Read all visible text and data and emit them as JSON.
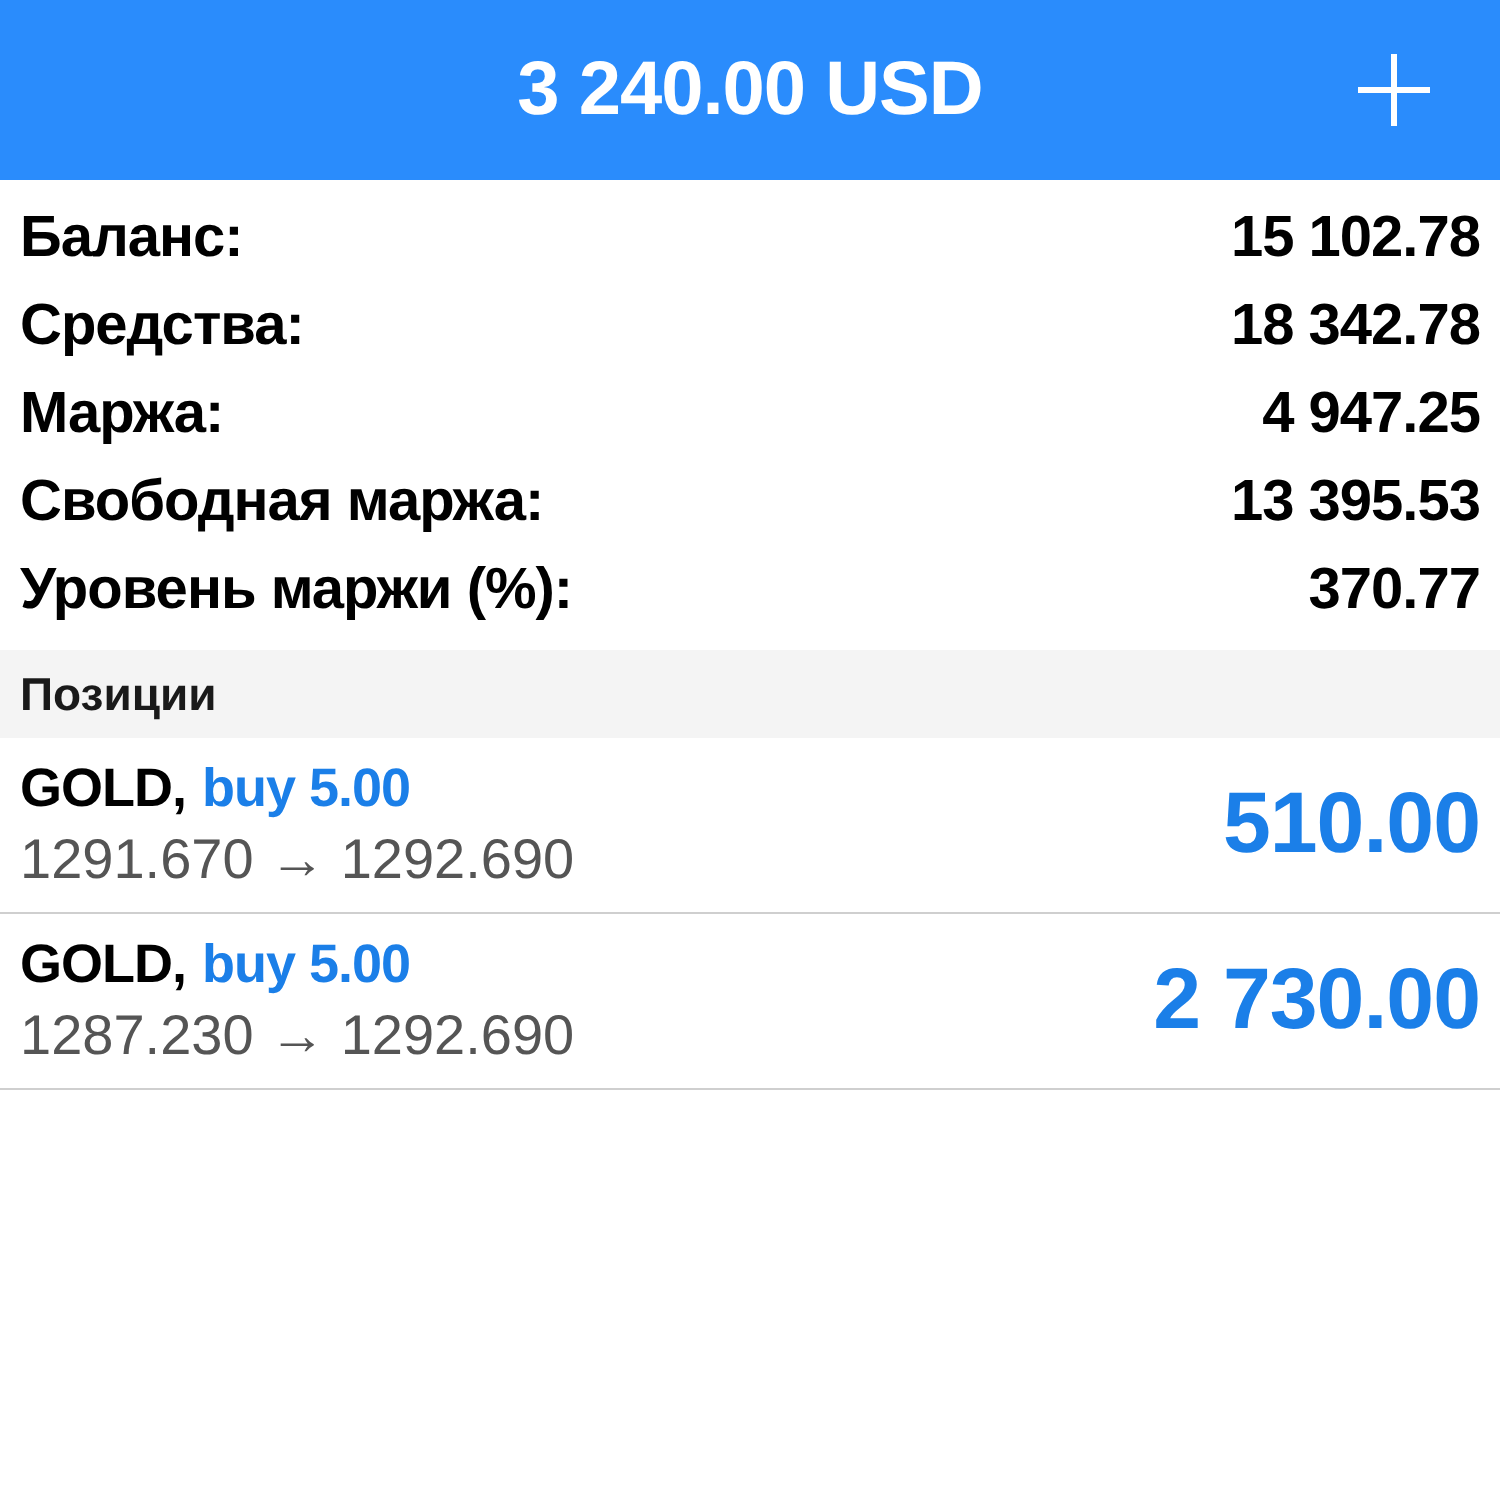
{
  "header": {
    "title": "3 240.00 USD"
  },
  "summary": [
    {
      "label": "Баланс:",
      "value": "15 102.78"
    },
    {
      "label": "Средства:",
      "value": "18 342.78"
    },
    {
      "label": "Маржа:",
      "value": "4 947.25"
    },
    {
      "label": "Свободная маржа:",
      "value": "13 395.53"
    },
    {
      "label": "Уровень маржи (%):",
      "value": "370.77"
    }
  ],
  "positions_section": {
    "title": "Позиции"
  },
  "positions": [
    {
      "symbol": "GOLD,",
      "trade": "buy 5.00",
      "prices": "1291.670 → 1292.690",
      "profit": "510.00"
    },
    {
      "symbol": "GOLD,",
      "trade": "buy 5.00",
      "prices": "1287.230 → 1292.690",
      "profit": "2 730.00"
    }
  ]
}
